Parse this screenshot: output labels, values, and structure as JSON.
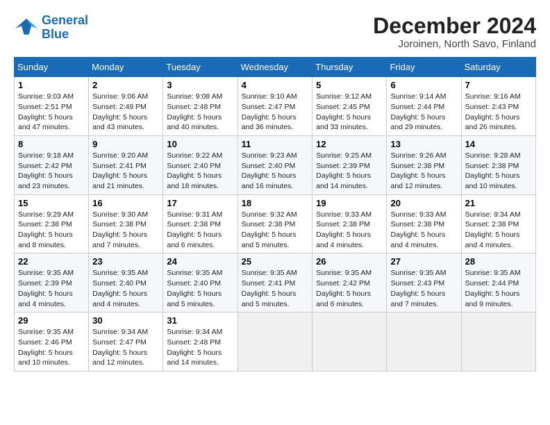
{
  "header": {
    "logo_line1": "General",
    "logo_line2": "Blue",
    "month_title": "December 2024",
    "subtitle": "Joroinen, North Savo, Finland"
  },
  "weekdays": [
    "Sunday",
    "Monday",
    "Tuesday",
    "Wednesday",
    "Thursday",
    "Friday",
    "Saturday"
  ],
  "weeks": [
    [
      {
        "day": "1",
        "info": "Sunrise: 9:03 AM\nSunset: 2:51 PM\nDaylight: 5 hours\nand 47 minutes."
      },
      {
        "day": "2",
        "info": "Sunrise: 9:06 AM\nSunset: 2:49 PM\nDaylight: 5 hours\nand 43 minutes."
      },
      {
        "day": "3",
        "info": "Sunrise: 9:08 AM\nSunset: 2:48 PM\nDaylight: 5 hours\nand 40 minutes."
      },
      {
        "day": "4",
        "info": "Sunrise: 9:10 AM\nSunset: 2:47 PM\nDaylight: 5 hours\nand 36 minutes."
      },
      {
        "day": "5",
        "info": "Sunrise: 9:12 AM\nSunset: 2:45 PM\nDaylight: 5 hours\nand 33 minutes."
      },
      {
        "day": "6",
        "info": "Sunrise: 9:14 AM\nSunset: 2:44 PM\nDaylight: 5 hours\nand 29 minutes."
      },
      {
        "day": "7",
        "info": "Sunrise: 9:16 AM\nSunset: 2:43 PM\nDaylight: 5 hours\nand 26 minutes."
      }
    ],
    [
      {
        "day": "8",
        "info": "Sunrise: 9:18 AM\nSunset: 2:42 PM\nDaylight: 5 hours\nand 23 minutes."
      },
      {
        "day": "9",
        "info": "Sunrise: 9:20 AM\nSunset: 2:41 PM\nDaylight: 5 hours\nand 21 minutes."
      },
      {
        "day": "10",
        "info": "Sunrise: 9:22 AM\nSunset: 2:40 PM\nDaylight: 5 hours\nand 18 minutes."
      },
      {
        "day": "11",
        "info": "Sunrise: 9:23 AM\nSunset: 2:40 PM\nDaylight: 5 hours\nand 16 minutes."
      },
      {
        "day": "12",
        "info": "Sunrise: 9:25 AM\nSunset: 2:39 PM\nDaylight: 5 hours\nand 14 minutes."
      },
      {
        "day": "13",
        "info": "Sunrise: 9:26 AM\nSunset: 2:38 PM\nDaylight: 5 hours\nand 12 minutes."
      },
      {
        "day": "14",
        "info": "Sunrise: 9:28 AM\nSunset: 2:38 PM\nDaylight: 5 hours\nand 10 minutes."
      }
    ],
    [
      {
        "day": "15",
        "info": "Sunrise: 9:29 AM\nSunset: 2:38 PM\nDaylight: 5 hours\nand 8 minutes."
      },
      {
        "day": "16",
        "info": "Sunrise: 9:30 AM\nSunset: 2:38 PM\nDaylight: 5 hours\nand 7 minutes."
      },
      {
        "day": "17",
        "info": "Sunrise: 9:31 AM\nSunset: 2:38 PM\nDaylight: 5 hours\nand 6 minutes."
      },
      {
        "day": "18",
        "info": "Sunrise: 9:32 AM\nSunset: 2:38 PM\nDaylight: 5 hours\nand 5 minutes."
      },
      {
        "day": "19",
        "info": "Sunrise: 9:33 AM\nSunset: 2:38 PM\nDaylight: 5 hours\nand 4 minutes."
      },
      {
        "day": "20",
        "info": "Sunrise: 9:33 AM\nSunset: 2:38 PM\nDaylight: 5 hours\nand 4 minutes."
      },
      {
        "day": "21",
        "info": "Sunrise: 9:34 AM\nSunset: 2:38 PM\nDaylight: 5 hours\nand 4 minutes."
      }
    ],
    [
      {
        "day": "22",
        "info": "Sunrise: 9:35 AM\nSunset: 2:39 PM\nDaylight: 5 hours\nand 4 minutes."
      },
      {
        "day": "23",
        "info": "Sunrise: 9:35 AM\nSunset: 2:40 PM\nDaylight: 5 hours\nand 4 minutes."
      },
      {
        "day": "24",
        "info": "Sunrise: 9:35 AM\nSunset: 2:40 PM\nDaylight: 5 hours\nand 5 minutes."
      },
      {
        "day": "25",
        "info": "Sunrise: 9:35 AM\nSunset: 2:41 PM\nDaylight: 5 hours\nand 5 minutes."
      },
      {
        "day": "26",
        "info": "Sunrise: 9:35 AM\nSunset: 2:42 PM\nDaylight: 5 hours\nand 6 minutes."
      },
      {
        "day": "27",
        "info": "Sunrise: 9:35 AM\nSunset: 2:43 PM\nDaylight: 5 hours\nand 7 minutes."
      },
      {
        "day": "28",
        "info": "Sunrise: 9:35 AM\nSunset: 2:44 PM\nDaylight: 5 hours\nand 9 minutes."
      }
    ],
    [
      {
        "day": "29",
        "info": "Sunrise: 9:35 AM\nSunset: 2:46 PM\nDaylight: 5 hours\nand 10 minutes."
      },
      {
        "day": "30",
        "info": "Sunrise: 9:34 AM\nSunset: 2:47 PM\nDaylight: 5 hours\nand 12 minutes."
      },
      {
        "day": "31",
        "info": "Sunrise: 9:34 AM\nSunset: 2:48 PM\nDaylight: 5 hours\nand 14 minutes."
      },
      {
        "day": "",
        "info": ""
      },
      {
        "day": "",
        "info": ""
      },
      {
        "day": "",
        "info": ""
      },
      {
        "day": "",
        "info": ""
      }
    ]
  ]
}
